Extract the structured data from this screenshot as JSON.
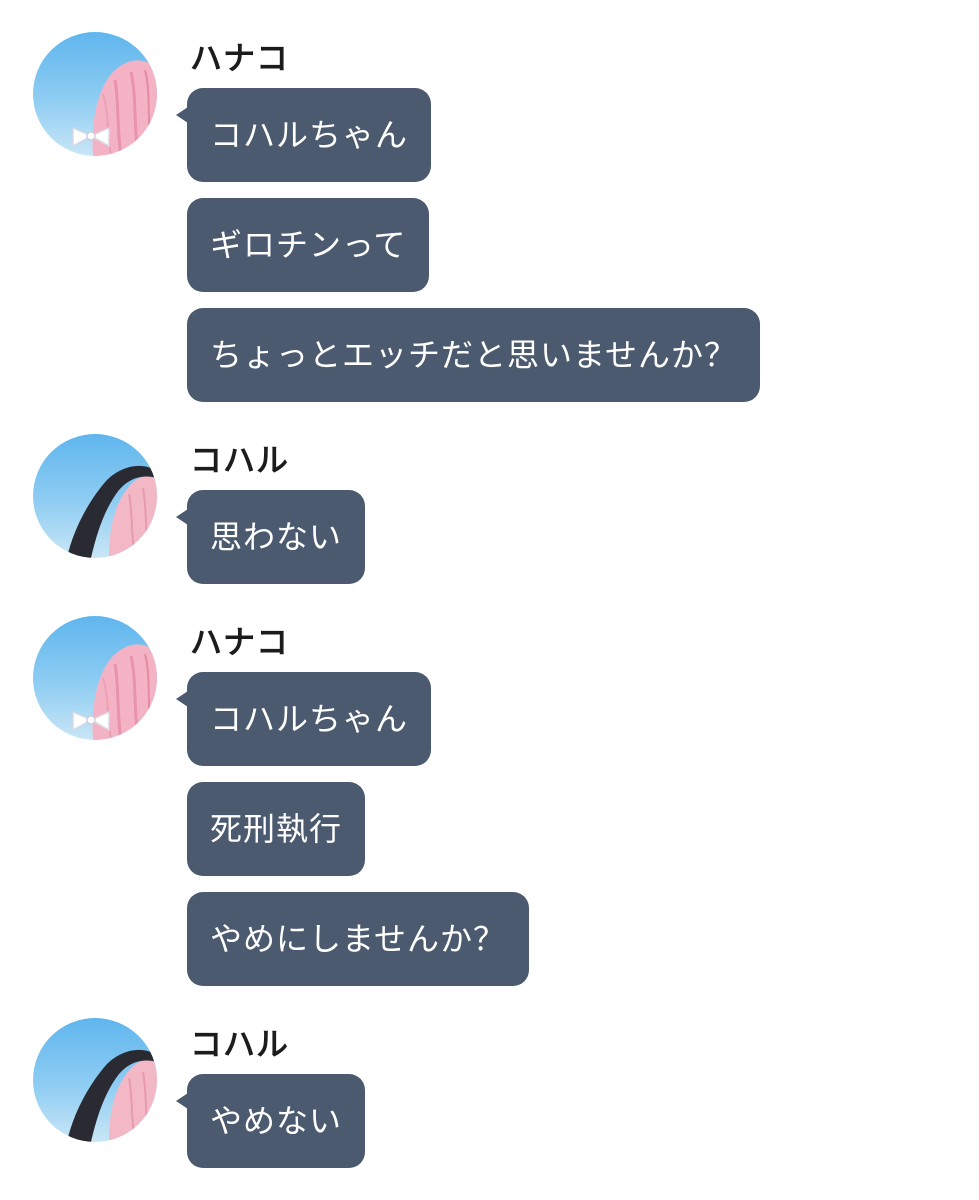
{
  "colors": {
    "bubble": "#4b5a6f",
    "bubble_text": "#ffffff",
    "sender_text": "#1c1c1e",
    "background": "#ffffff"
  },
  "messages": [
    {
      "sender": "ハナコ",
      "avatar": "hanako-avatar",
      "bubbles": [
        "コハルちゃん",
        "ギロチンって",
        "ちょっとエッチだと思いませんか？"
      ]
    },
    {
      "sender": "コハル",
      "avatar": "koharu-avatar",
      "bubbles": [
        "思わない"
      ]
    },
    {
      "sender": "ハナコ",
      "avatar": "hanako-avatar",
      "bubbles": [
        "コハルちゃん",
        "死刑執行",
        "やめにしませんか？"
      ]
    },
    {
      "sender": "コハル",
      "avatar": "koharu-avatar",
      "bubbles": [
        "やめない"
      ]
    }
  ]
}
